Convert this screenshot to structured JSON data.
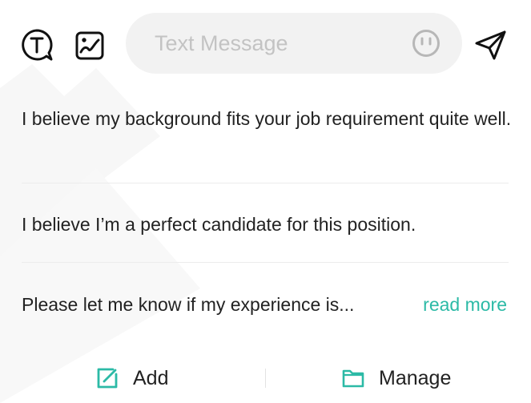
{
  "toolbar": {
    "icons": [
      "text-format-icon",
      "image-gallery-icon",
      "send-icon"
    ],
    "message_input": {
      "placeholder": "Text Message",
      "value": "",
      "emoji_icon": "emoji-icon"
    }
  },
  "phrases": {
    "items": [
      {
        "text": "I believe my background fits your job requirement quite well."
      },
      {
        "text": "I believe I’m a perfect candidate for this position."
      },
      {
        "text": "Please let me know if my experience is...",
        "action_label": "read more"
      }
    ]
  },
  "bottom_bar": {
    "add_label": "Add",
    "add_icon": "edit-square-icon",
    "manage_label": "Manage",
    "manage_icon": "folder-icon"
  },
  "colors": {
    "accent": "#2cbaa6",
    "input_background": "#f2f2f2",
    "placeholder": "#c3c3c3",
    "text": "#222222",
    "divider": "#ececec"
  }
}
